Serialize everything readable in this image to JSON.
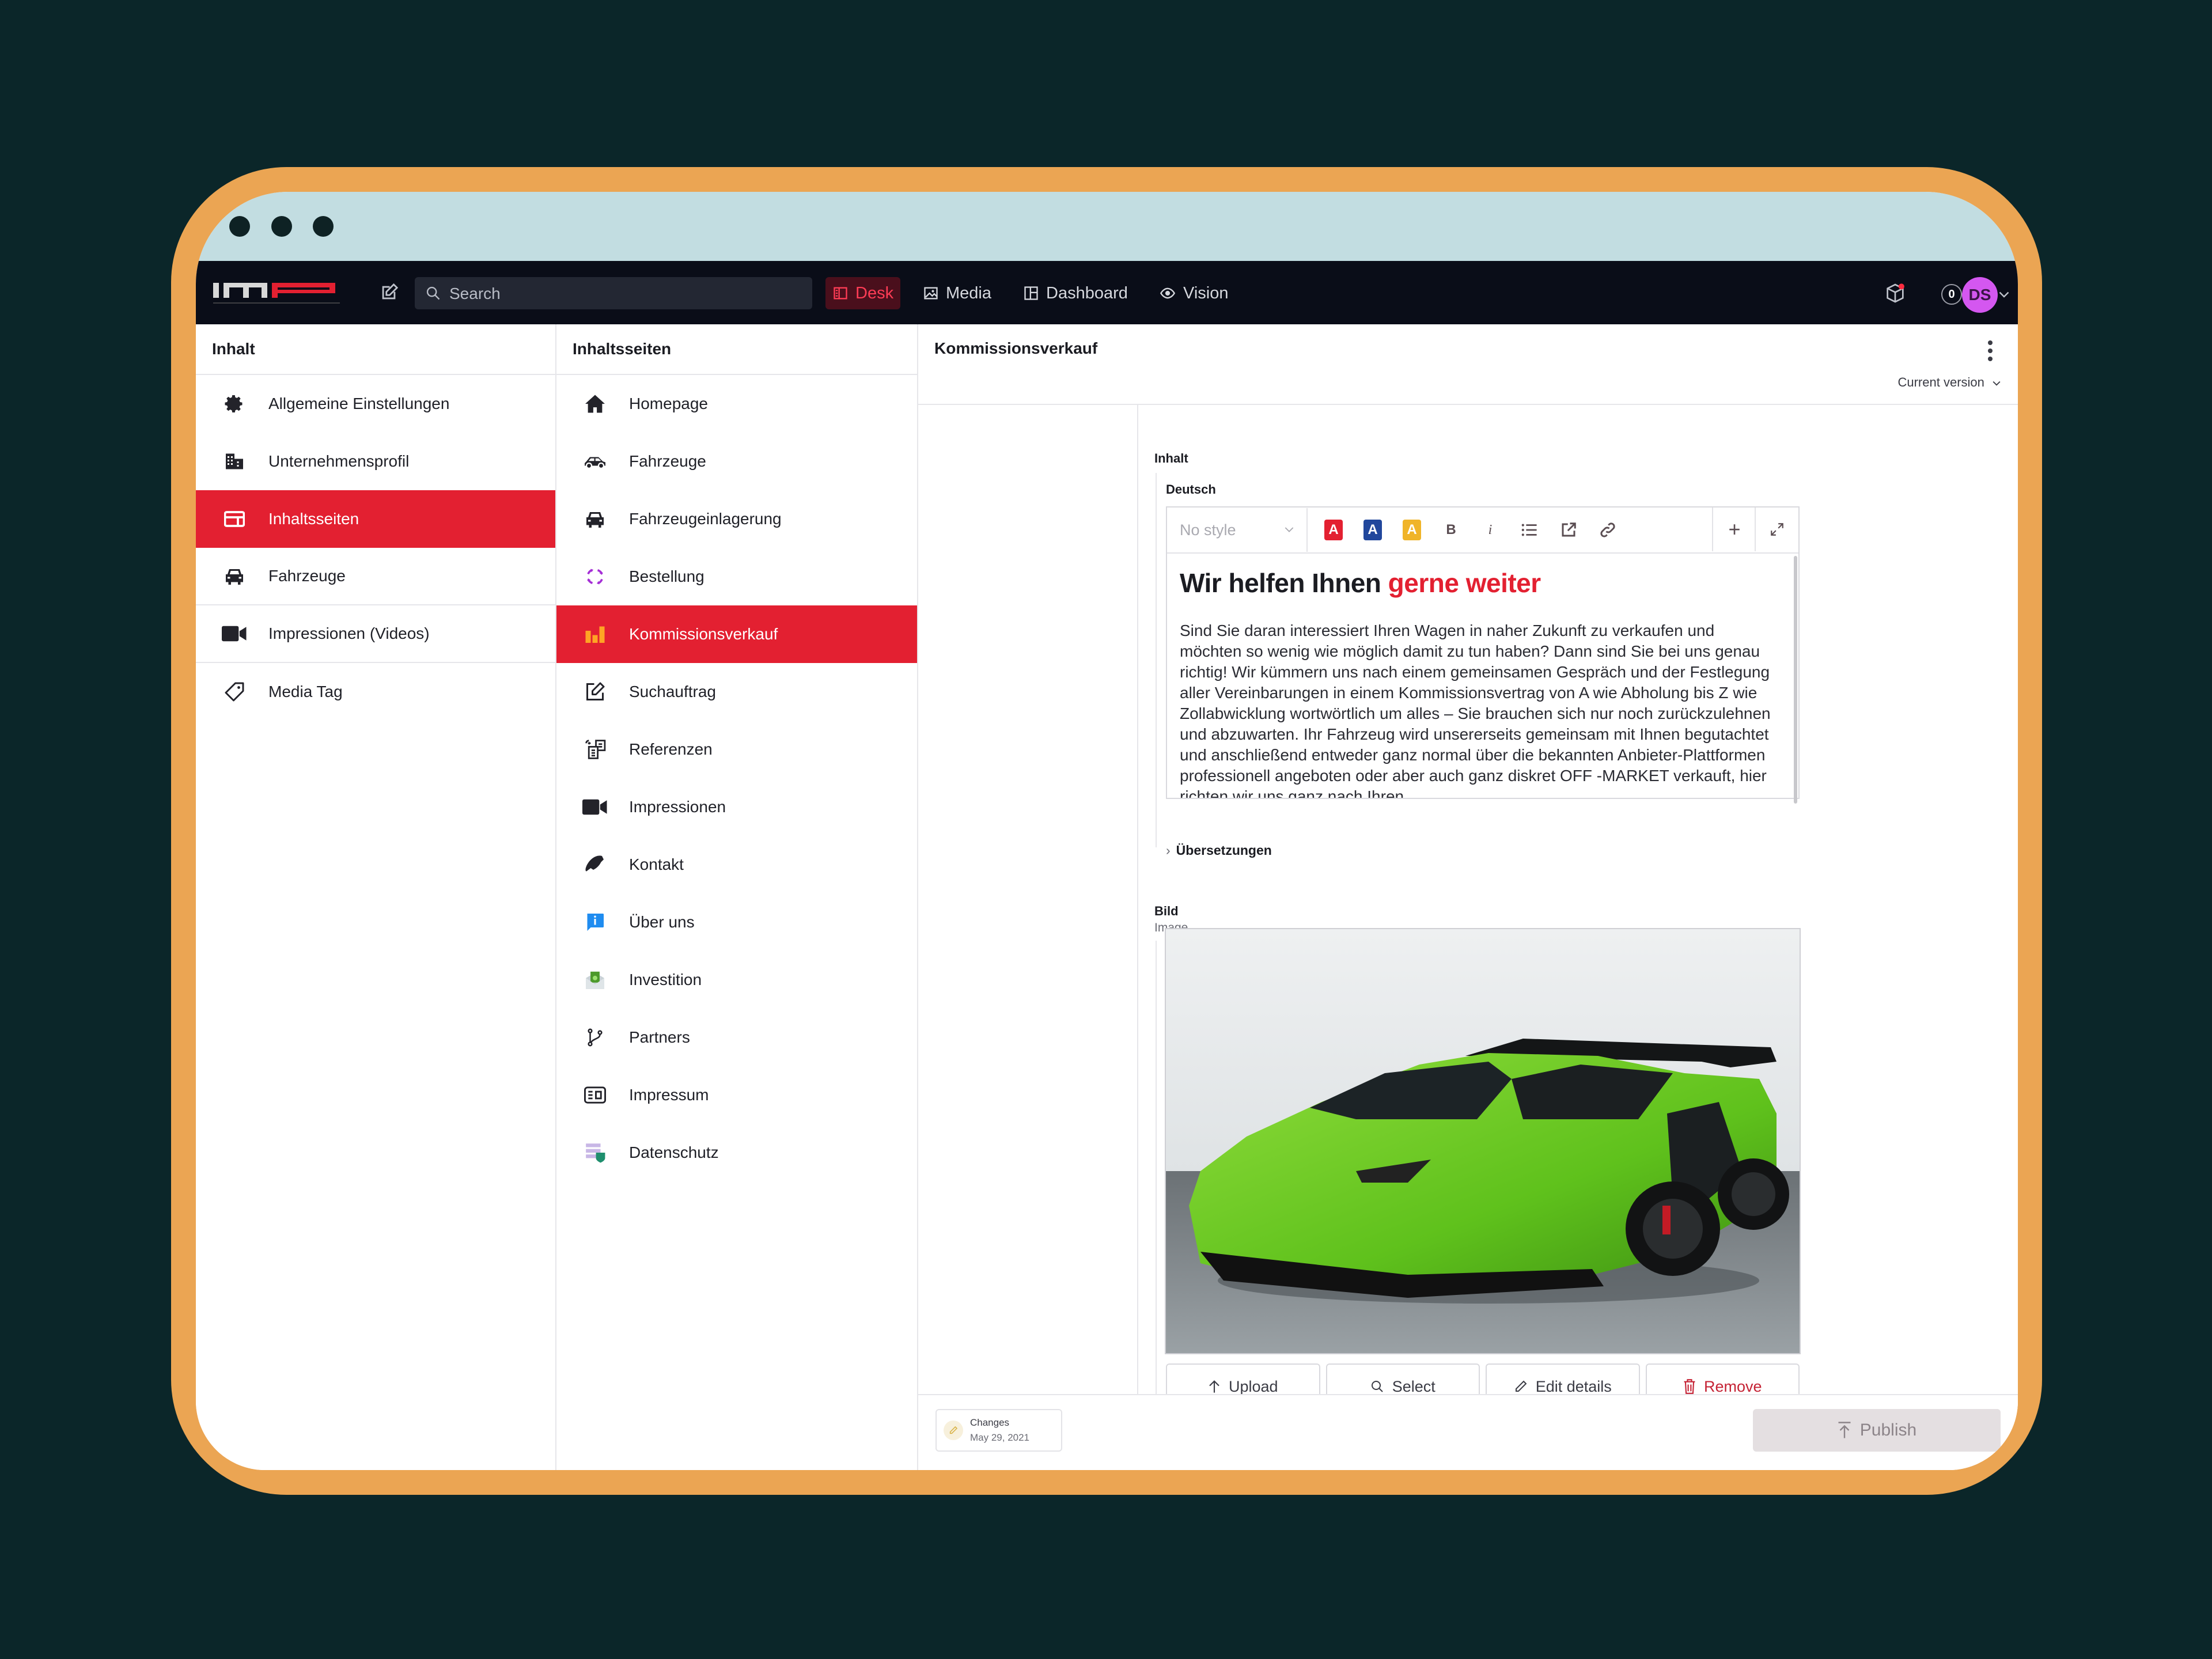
{
  "window": {
    "controls": [
      "dot-1",
      "dot-2",
      "dot-3"
    ]
  },
  "navbar": {
    "logo_text": "MP",
    "logo_subtitle": "MAXIMUM PERFORMANCE",
    "search_placeholder": "Search",
    "tabs": [
      {
        "label": "Desk",
        "icon": "desk-icon",
        "active": true
      },
      {
        "label": "Media",
        "icon": "image-icon",
        "active": false
      },
      {
        "label": "Dashboard",
        "icon": "dashboard-icon",
        "active": false
      },
      {
        "label": "Vision",
        "icon": "eye-icon",
        "active": false
      }
    ],
    "notification_count": "0",
    "avatar_initials": "DS",
    "colors": {
      "accent": "#e32031",
      "avatar": "#d457f0",
      "navbar_bg": "#0a0d18"
    }
  },
  "col1": {
    "title": "Inhalt",
    "items": [
      {
        "label": "Allgemeine Einstellungen",
        "icon": "gear-icon"
      },
      {
        "label": "Unternehmensprofil",
        "icon": "building-icon"
      },
      {
        "label": "Inhaltsseiten",
        "icon": "layout-icon",
        "active": true
      },
      {
        "label": "Fahrzeuge",
        "icon": "car-icon"
      },
      {
        "label": "Impressionen (Videos)",
        "icon": "video-icon"
      },
      {
        "label": "Media Tag",
        "icon": "tag-icon"
      }
    ]
  },
  "col2": {
    "title": "Inhaltsseiten",
    "items": [
      {
        "label": "Homepage",
        "icon": "home-icon"
      },
      {
        "label": "Fahrzeuge",
        "icon": "car-side-icon"
      },
      {
        "label": "Fahrzeugeinlagerung",
        "icon": "car-front-icon"
      },
      {
        "label": "Bestellung",
        "icon": "refresh-arrows-icon"
      },
      {
        "label": "Kommissionsverkauf",
        "icon": "bar-chart-icon",
        "active": true
      },
      {
        "label": "Suchauftrag",
        "icon": "edit-icon"
      },
      {
        "label": "Referenzen",
        "icon": "documents-icon"
      },
      {
        "label": "Impressionen",
        "icon": "video-icon"
      },
      {
        "label": "Kontakt",
        "icon": "phone-icon"
      },
      {
        "label": "Über uns",
        "icon": "info-bubble-icon"
      },
      {
        "label": "Investition",
        "icon": "money-envelope-icon"
      },
      {
        "label": "Partners",
        "icon": "git-branch-icon"
      },
      {
        "label": "Impressum",
        "icon": "id-card-icon"
      },
      {
        "label": "Datenschutz",
        "icon": "data-shield-icon"
      }
    ]
  },
  "document": {
    "title": "Kommissionsverkauf",
    "version_label": "Current version",
    "content_label": "Inhalt",
    "language_label": "Deutsch",
    "editor": {
      "style_placeholder": "No style",
      "toolbar": [
        "text-color-red",
        "text-color-blue",
        "text-color-yellow",
        "bold",
        "italic",
        "bullet-list",
        "external-link",
        "link",
        "insert",
        "fullscreen"
      ],
      "heading_plain": "Wir helfen Ihnen ",
      "heading_highlight": "gerne weiter",
      "paragraph": "Sind Sie daran interessiert Ihren Wagen in naher Zukunft zu verkaufen und möchten so wenig wie möglich damit zu tun haben? Dann sind Sie bei uns genau richtig! Wir kümmern uns nach einem gemeinsamen Gespräch und der Festlegung aller Vereinbarungen in einem Kommissionsvertrag von A wie Abholung bis Z wie Zollabwicklung wortwörtlich um alles – Sie brauchen sich nur noch zurückzulehnen und abzuwarten. Ihr Fahrzeug wird unsererseits gemeinsam mit Ihnen begutachtet und anschließend entweder ganz normal über die bekannten Anbieter-Plattformen professionell angeboten oder aber auch ganz diskret OFF -MARKET verkauft, hier richten wir uns ganz nach Ihren"
    },
    "translations_label": "Übersetzungen",
    "image_field": {
      "label": "Bild",
      "sublabel": "Image",
      "buttons": [
        "Upload",
        "Select",
        "Edit details",
        "Remove"
      ]
    },
    "footer": {
      "changes_label": "Changes",
      "changes_date": "May 29, 2021",
      "publish_label": "Publish"
    }
  }
}
